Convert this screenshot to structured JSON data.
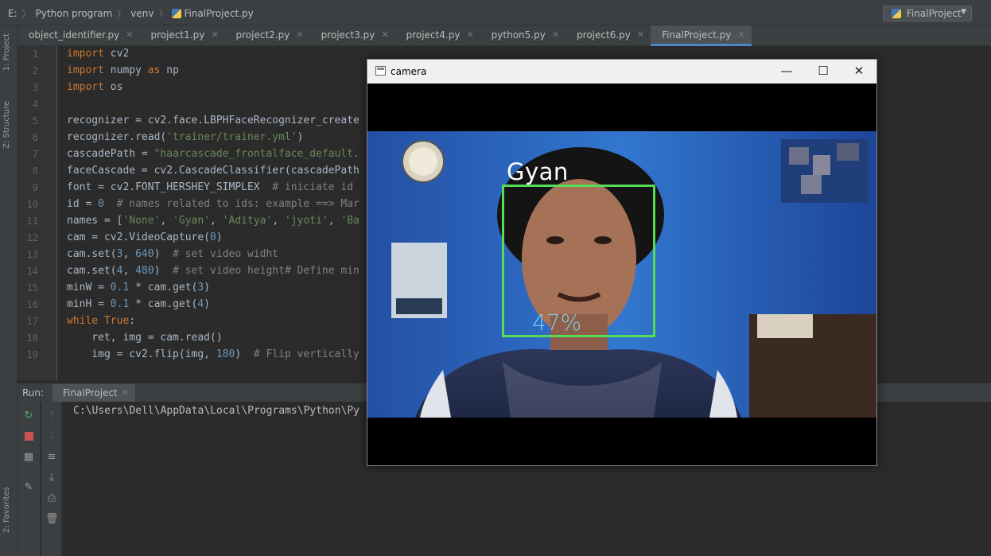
{
  "breadcrumb": {
    "root": "E:",
    "items": [
      "Python program",
      "venv",
      "FinalProject.py"
    ]
  },
  "run_config": {
    "label": "FinalProject"
  },
  "left_strip": {
    "project": "1: Project",
    "structure": "Z: Structure",
    "favorites": "2: Favorites"
  },
  "tabs": [
    {
      "label": "object_identifier.py",
      "active": false
    },
    {
      "label": "project1.py",
      "active": false
    },
    {
      "label": "project2.py",
      "active": false
    },
    {
      "label": "project3.py",
      "active": false
    },
    {
      "label": "project4.py",
      "active": false
    },
    {
      "label": "python5.py",
      "active": false
    },
    {
      "label": "project6.py",
      "active": false
    },
    {
      "label": "FinalProject.py",
      "active": true
    }
  ],
  "code_lines": [
    {
      "n": "1",
      "text": "import cv2"
    },
    {
      "n": "2",
      "text": "import numpy as np"
    },
    {
      "n": "3",
      "text": "import os"
    },
    {
      "n": "4",
      "text": ""
    },
    {
      "n": "5",
      "text": "recognizer = cv2.face.LBPHFaceRecognizer_create"
    },
    {
      "n": "6",
      "text": "recognizer.read('trainer/trainer.yml')"
    },
    {
      "n": "7",
      "text": "cascadePath = \"haarcascade_frontalface_default."
    },
    {
      "n": "8",
      "text": "faceCascade = cv2.CascadeClassifier(cascadePath"
    },
    {
      "n": "9",
      "text": "font = cv2.FONT_HERSHEY_SIMPLEX  # iniciate id"
    },
    {
      "n": "10",
      "text": "id = 0  # names related to ids: example ==> Mar"
    },
    {
      "n": "11",
      "text": "names = ['None', 'Gyan', 'Aditya', 'jyoti', 'Ba"
    },
    {
      "n": "12",
      "text": "cam = cv2.VideoCapture(0)"
    },
    {
      "n": "13",
      "text": "cam.set(3, 640)  # set video widht"
    },
    {
      "n": "14",
      "text": "cam.set(4, 480)  # set video height# Define min"
    },
    {
      "n": "15",
      "text": "minW = 0.1 * cam.get(3)"
    },
    {
      "n": "16",
      "text": "minH = 0.1 * cam.get(4)"
    },
    {
      "n": "17",
      "text": "while True:"
    },
    {
      "n": "18",
      "text": "    ret, img = cam.read()"
    },
    {
      "n": "19",
      "text": "    img = cv2.flip(img, 180)  # Flip vertically"
    }
  ],
  "run": {
    "label": "Run:",
    "tab": "FinalProject",
    "console": "C:\\Users\\Dell\\AppData\\Local\\Programs\\Python\\Py"
  },
  "camera_window": {
    "title": "camera",
    "minimize": "—",
    "maximize": "☐",
    "close": "✕",
    "detected_name": "Gyan",
    "confidence": "47%"
  },
  "colors": {
    "face_box": "#55dd55",
    "confidence_text": "#7fe0ff",
    "active_tab_underline": "#4a88c7"
  }
}
